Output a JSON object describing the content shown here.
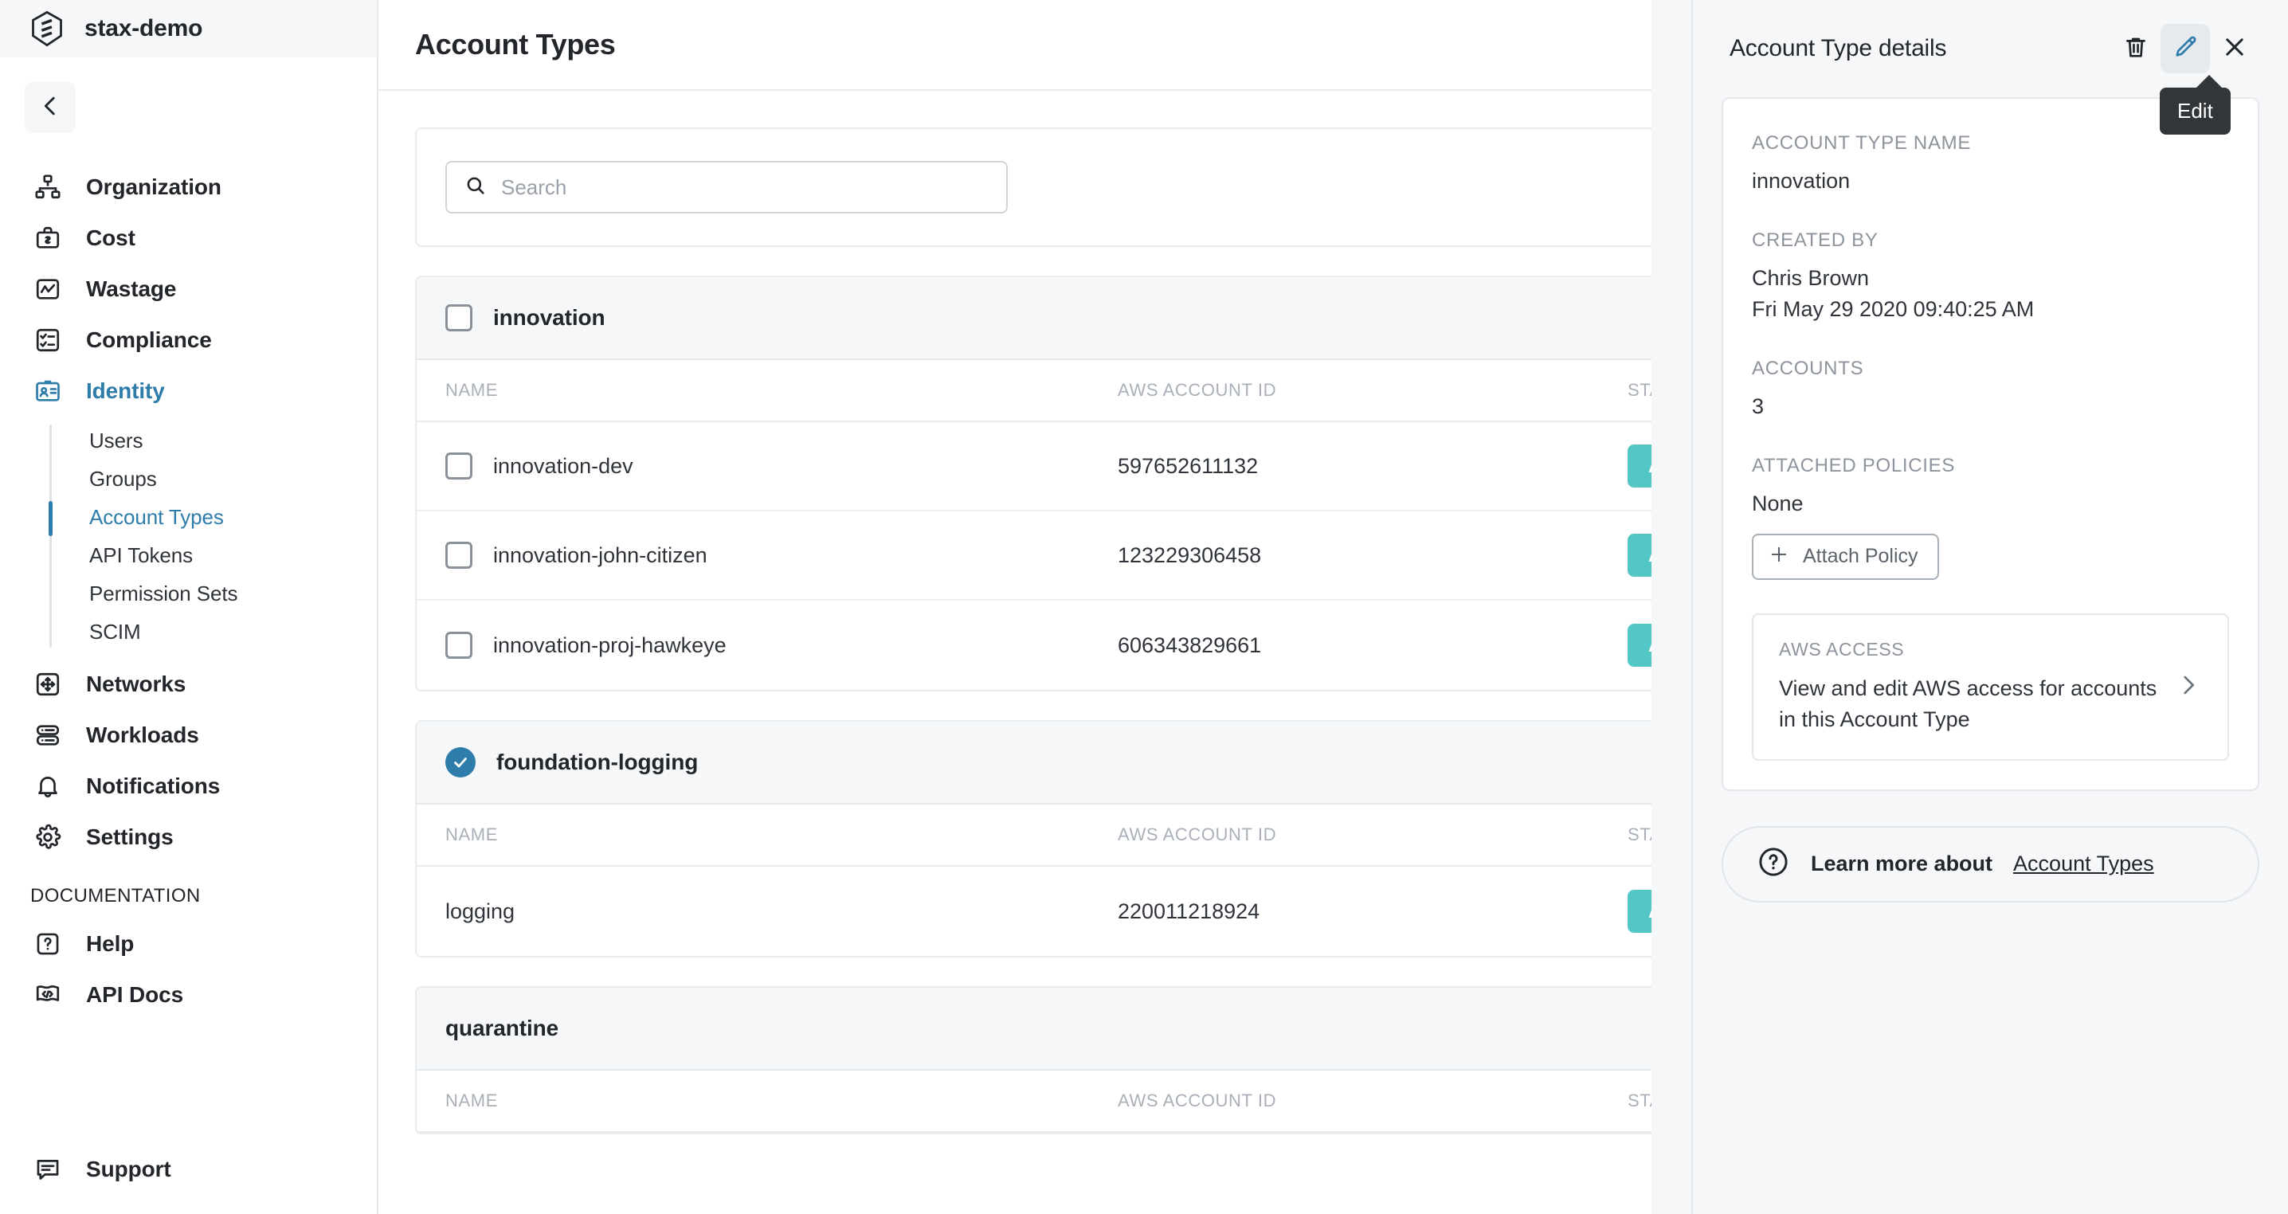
{
  "brand": {
    "name": "stax-demo",
    "logo_icon": "stax-hexagon-logo"
  },
  "sidebar": {
    "collapse_icon": "chevron-left-icon",
    "items": [
      {
        "label": "Organization",
        "icon": "org-chart-icon",
        "active": false
      },
      {
        "label": "Cost",
        "icon": "briefcase-dollar-icon",
        "active": false
      },
      {
        "label": "Wastage",
        "icon": "line-chart-icon",
        "active": false
      },
      {
        "label": "Compliance",
        "icon": "checklist-icon",
        "active": false
      },
      {
        "label": "Identity",
        "icon": "id-card-icon",
        "active": true
      },
      {
        "label": "Networks",
        "icon": "arrows-expand-icon",
        "active": false
      },
      {
        "label": "Workloads",
        "icon": "server-stack-icon",
        "active": false
      },
      {
        "label": "Notifications",
        "icon": "bell-icon",
        "active": false
      },
      {
        "label": "Settings",
        "icon": "gear-icon",
        "active": false
      }
    ],
    "identity_subitems": [
      {
        "label": "Users",
        "active": false
      },
      {
        "label": "Groups",
        "active": false
      },
      {
        "label": "Account Types",
        "active": true
      },
      {
        "label": "API Tokens",
        "active": false
      },
      {
        "label": "Permission Sets",
        "active": false
      },
      {
        "label": "SCIM",
        "active": false
      }
    ],
    "documentation_label": "DOCUMENTATION",
    "documentation_items": [
      {
        "label": "Help",
        "icon": "question-box-icon"
      },
      {
        "label": "API Docs",
        "icon": "code-flag-icon"
      }
    ],
    "support": {
      "label": "Support",
      "icon": "chat-bubble-icon"
    }
  },
  "main": {
    "page_title": "Account Types",
    "search": {
      "placeholder": "Search",
      "value": "",
      "icon": "search-icon"
    },
    "columns": [
      "NAME",
      "AWS ACCOUNT ID",
      "STATUS"
    ],
    "groups": [
      {
        "name": "innovation",
        "checked": false,
        "show_row_checkboxes": true,
        "rows": [
          {
            "name": "innovation-dev",
            "account_id": "597652611132",
            "status": "ACTIVE"
          },
          {
            "name": "innovation-john-citizen",
            "account_id": "123229306458",
            "status": "ACTIVE"
          },
          {
            "name": "innovation-proj-hawkeye",
            "account_id": "606343829661",
            "status": "ACTIVE"
          }
        ]
      },
      {
        "name": "foundation-logging",
        "checked": true,
        "show_row_checkboxes": false,
        "rows": [
          {
            "name": "logging",
            "account_id": "220011218924",
            "status": "ACTIVE"
          }
        ]
      },
      {
        "name": "quarantine",
        "checked": false,
        "show_row_checkboxes": false,
        "rows": []
      }
    ]
  },
  "panel": {
    "title": "Account Type details",
    "actions": [
      {
        "name": "delete",
        "icon": "trash-icon",
        "selected": false
      },
      {
        "name": "edit",
        "icon": "pencil-icon",
        "selected": true
      },
      {
        "name": "close",
        "icon": "close-icon",
        "selected": false
      }
    ],
    "tooltip": "Edit",
    "fields": {
      "account_type_name_label": "ACCOUNT TYPE NAME",
      "account_type_name_value": "innovation",
      "created_by_label": "CREATED BY",
      "created_by_value": "Chris Brown",
      "created_at_value": "Fri May 29 2020 09:40:25 AM",
      "accounts_label": "ACCOUNTS",
      "accounts_value": "3",
      "attached_policies_label": "ATTACHED POLICIES",
      "attached_policies_value": "None",
      "attach_policy_button": "Attach Policy"
    },
    "aws_access": {
      "label": "AWS ACCESS",
      "text": "View and edit AWS access for accounts in this Account Type",
      "chevron_icon": "chevron-right-icon"
    },
    "learn_more": {
      "icon": "question-circle-icon",
      "text": "Learn more about",
      "link": "Account Types"
    }
  },
  "colors": {
    "accent_blue": "#2e7caa",
    "status_teal": "#53c6c6",
    "panel_bg": "#f6f7f9",
    "tooltip_bg": "#333638",
    "text_dark": "#22262b",
    "text_muted": "#8d949c"
  }
}
